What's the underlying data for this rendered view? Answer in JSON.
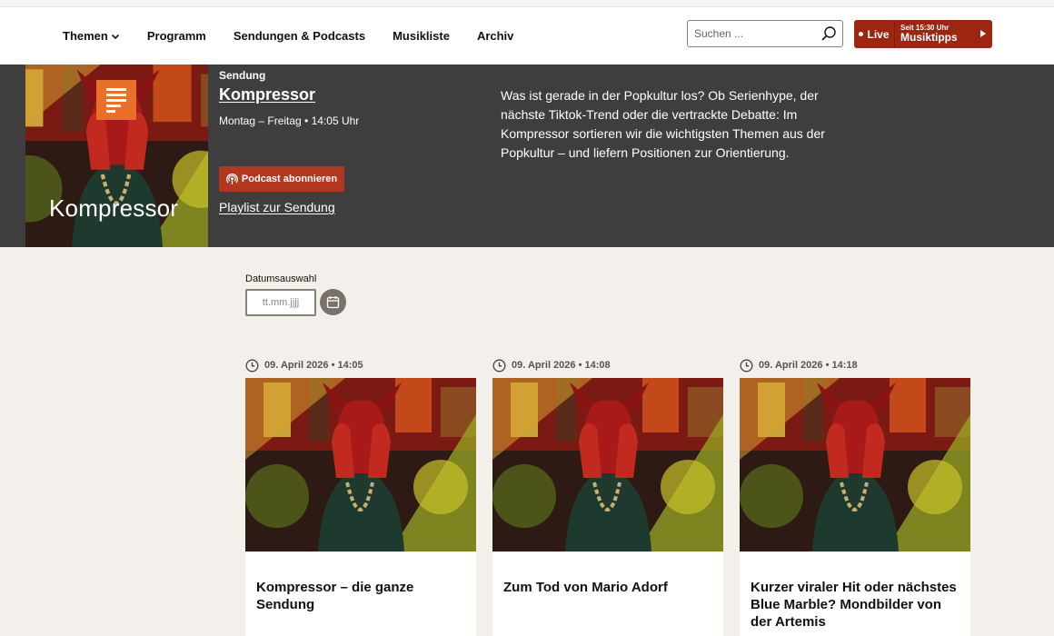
{
  "nav": {
    "items": [
      {
        "label": "Themen",
        "has_dropdown": true
      },
      {
        "label": "Programm"
      },
      {
        "label": "Sendungen & Podcasts"
      },
      {
        "label": "Musikliste"
      },
      {
        "label": "Archiv"
      }
    ]
  },
  "search": {
    "placeholder": "Suchen ..."
  },
  "live": {
    "label": "Live",
    "since": "Seit 15:30 Uhr",
    "program": "Musiktipps"
  },
  "hero": {
    "kicker": "Sendung",
    "title": "Kompressor",
    "image_text": "Kompressor",
    "schedule": "Montag – Freitag • 14:05 Uhr",
    "podcast_button": "Podcast abonnieren",
    "playlist_link": "Playlist zur Sendung",
    "description": "Was ist gerade in der Popkultur los? Ob Serienhype, der nächste Tiktok-Trend oder die vertrackte Debatte: Im Kompressor sortieren wir die wichtigsten Themen aus der Popkultur – und liefern Positionen zur Orientierung."
  },
  "date_picker": {
    "label": "Datumsauswahl",
    "placeholder": "tt.mm.jjjj"
  },
  "cards": [
    {
      "meta": "09. April 2026 • 14:05",
      "title": "Kompressor – die ganze Sendung"
    },
    {
      "meta": "09. April 2026 • 14:08",
      "title": "Zum Tod von Mario Adorf"
    },
    {
      "meta": "09. April 2026 • 14:18",
      "title": "Kurzer viraler Hit oder nächstes Blue Marble? Mondbilder von der Artemis"
    }
  ],
  "colors": {
    "accent": "#9c2612",
    "button": "#b2371f",
    "hero_bg": "#3e3e3e",
    "page_bg": "#f3f0eb",
    "logo": "#e8702a"
  }
}
